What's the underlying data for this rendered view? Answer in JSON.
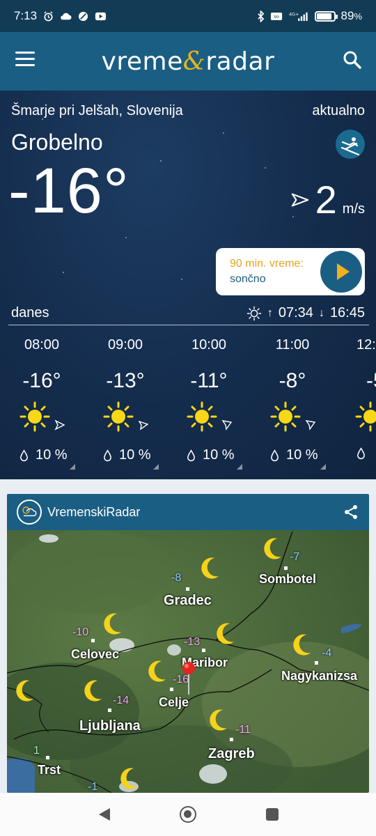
{
  "status_bar": {
    "time": "7:13",
    "battery": "89",
    "battery_unit": "%",
    "battery_level": 0.89,
    "icons": [
      "alarm-icon",
      "cloud-icon",
      "vpn-icon",
      "youtube-icon",
      "bluetooth-icon",
      "volte-icon",
      "signal-icon",
      "battery-icon"
    ]
  },
  "app_bar": {
    "logo_part1": "vreme",
    "logo_amp": "&",
    "logo_part2": "radar",
    "icons": [
      "menu-icon",
      "search-icon"
    ]
  },
  "current": {
    "region": "Šmarje pri Jelšah, Slovenija",
    "status": "aktualno",
    "town": "Grobelno",
    "temperature": "-16°",
    "wind_speed": "2",
    "wind_unit": "m/s"
  },
  "forecast_90": {
    "title": "90 min. vreme:",
    "condition": "sončno"
  },
  "today": {
    "label": "danes",
    "sunrise": "07:34",
    "sunset": "16:45"
  },
  "hours": [
    {
      "time": "08:00",
      "temp": "-16°",
      "rain": "10 %"
    },
    {
      "time": "09:00",
      "temp": "-13°",
      "rain": "10 %"
    },
    {
      "time": "10:00",
      "temp": "-11°",
      "rain": "10 %"
    },
    {
      "time": "11:00",
      "temp": "-8°",
      "rain": "10 %"
    },
    {
      "time": "12:",
      "temp": "-5",
      "rain": ""
    }
  ],
  "radar": {
    "title": "VremenskiRadar",
    "cities": [
      {
        "name": "Sombotel"
      },
      {
        "name": "Gradec"
      },
      {
        "name": "Celovec"
      },
      {
        "name": "Maribor"
      },
      {
        "name": "Nagykanizsa"
      },
      {
        "name": "Celje"
      },
      {
        "name": "Ljubljana"
      },
      {
        "name": "Zagreb"
      },
      {
        "name": "Trst"
      }
    ],
    "temps": [
      "-7",
      "-8",
      "-10",
      "-13",
      "-4",
      "-16",
      "-14",
      "-11",
      "1",
      "-1"
    ]
  },
  "colors": {
    "accent": "#1b5e83",
    "sky": "#142c4c",
    "sun": "#f7d716",
    "forecast_highlight": "#e3a51c"
  }
}
